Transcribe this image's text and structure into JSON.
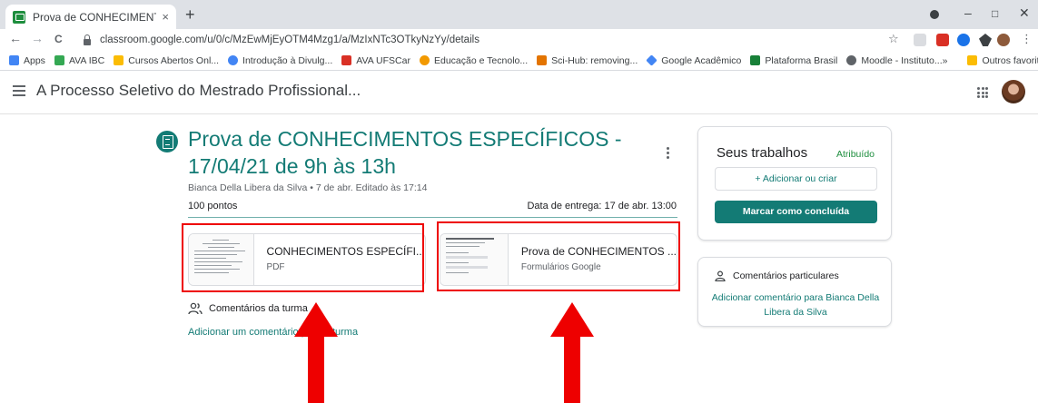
{
  "browser": {
    "tab_title": "Prova de CONHECIMENTOS ESPE",
    "tab_close": "×",
    "new_tab": "+",
    "window_controls": [
      "–",
      "□",
      "✕"
    ],
    "url": "classroom.google.com/u/0/c/MzEwMjEyOTM4Mzg1/a/MzIxNTc3OTkyNzYy/details",
    "nav": {
      "back": "←",
      "forward": "→",
      "reload": "C",
      "star": "☆",
      "menu": "⋮"
    },
    "bookmarks": [
      {
        "label": "Apps",
        "color": "#4285f4"
      },
      {
        "label": "AVA IBC",
        "color": "#34a853"
      },
      {
        "label": "Cursos Abertos Onl...",
        "color": "#fbbc04"
      },
      {
        "label": "Introdução à Divulg...",
        "color": "#4285f4"
      },
      {
        "label": "AVA UFSCar",
        "color": "#d93025"
      },
      {
        "label": "Educação e Tecnolo...",
        "color": "#f29900"
      },
      {
        "label": "Sci-Hub: removing...",
        "color": "#e37400"
      },
      {
        "label": "Google Acadêmico",
        "color": "#4285f4"
      },
      {
        "label": "Plataforma Brasil",
        "color": "#188038"
      },
      {
        "label": "Moodle - Instituto...",
        "color": "#5f6368"
      }
    ],
    "bookmarks_more": "»",
    "other_bookmarks": "Outros favoritos"
  },
  "header": {
    "class_title": "A Processo Seletivo do Mestrado Profissional..."
  },
  "assignment": {
    "title": "Prova de CONHECIMENTOS ESPECÍFICOS - 17/04/21 de 9h às 13h",
    "meta": "Bianca Della Libera da Silva • 7 de abr. Editado às 17:14",
    "points": "100 pontos",
    "due": "Data de entrega: 17 de abr. 13:00",
    "attachments": [
      {
        "name": "CONHECIMENTOS ESPECÍFI...",
        "type": "PDF"
      },
      {
        "name": "Prova de CONHECIMENTOS ...",
        "type": "Formulários Google"
      }
    ],
    "class_comments_label": "Comentários da turma",
    "add_class_comment": "Adicionar um comentário para a turma"
  },
  "work_card": {
    "title": "Seus trabalhos",
    "status": "Atribuído",
    "add_button": "+ Adicionar ou criar",
    "done_button": "Marcar como concluída"
  },
  "private_card": {
    "title": "Comentários particulares",
    "link": "Adicionar comentário para Bianca Della Libera da Silva"
  },
  "colors": {
    "accent": "#137b75",
    "highlight": "#e00000"
  }
}
